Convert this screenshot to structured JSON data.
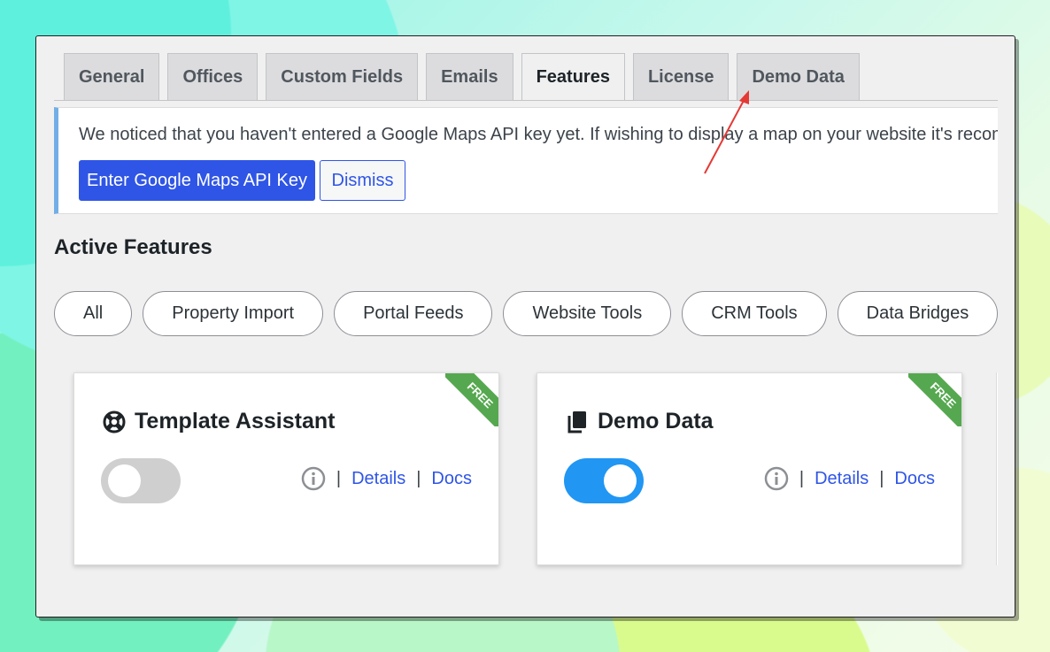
{
  "tabs": [
    {
      "label": "General",
      "active": false
    },
    {
      "label": "Offices",
      "active": false
    },
    {
      "label": "Custom Fields",
      "active": false
    },
    {
      "label": "Emails",
      "active": false
    },
    {
      "label": "Features",
      "active": true
    },
    {
      "label": "License",
      "active": false
    },
    {
      "label": "Demo Data",
      "active": false
    }
  ],
  "notice": {
    "text": "We noticed that you haven't entered a Google Maps API key yet. If wishing to display a map on your website it's recommended",
    "primary_button": "Enter Google Maps API Key",
    "dismiss_button": "Dismiss"
  },
  "section_title": "Active Features",
  "filters": [
    "All",
    "Property Import",
    "Portal Feeds",
    "Website Tools",
    "CRM Tools",
    "Data Bridges"
  ],
  "cards": [
    {
      "title": "Template Assistant",
      "badge": "FREE",
      "icon": "life-ring-icon",
      "enabled": false,
      "details_label": "Details",
      "docs_label": "Docs",
      "separator": "|"
    },
    {
      "title": "Demo Data",
      "badge": "FREE",
      "icon": "copy-icon",
      "enabled": true,
      "details_label": "Details",
      "docs_label": "Docs",
      "separator": "|"
    }
  ],
  "colors": {
    "accent": "#2f55e6",
    "toggle_on": "#2196f3",
    "badge": "#55a84f",
    "annotation_arrow": "#e53935"
  }
}
